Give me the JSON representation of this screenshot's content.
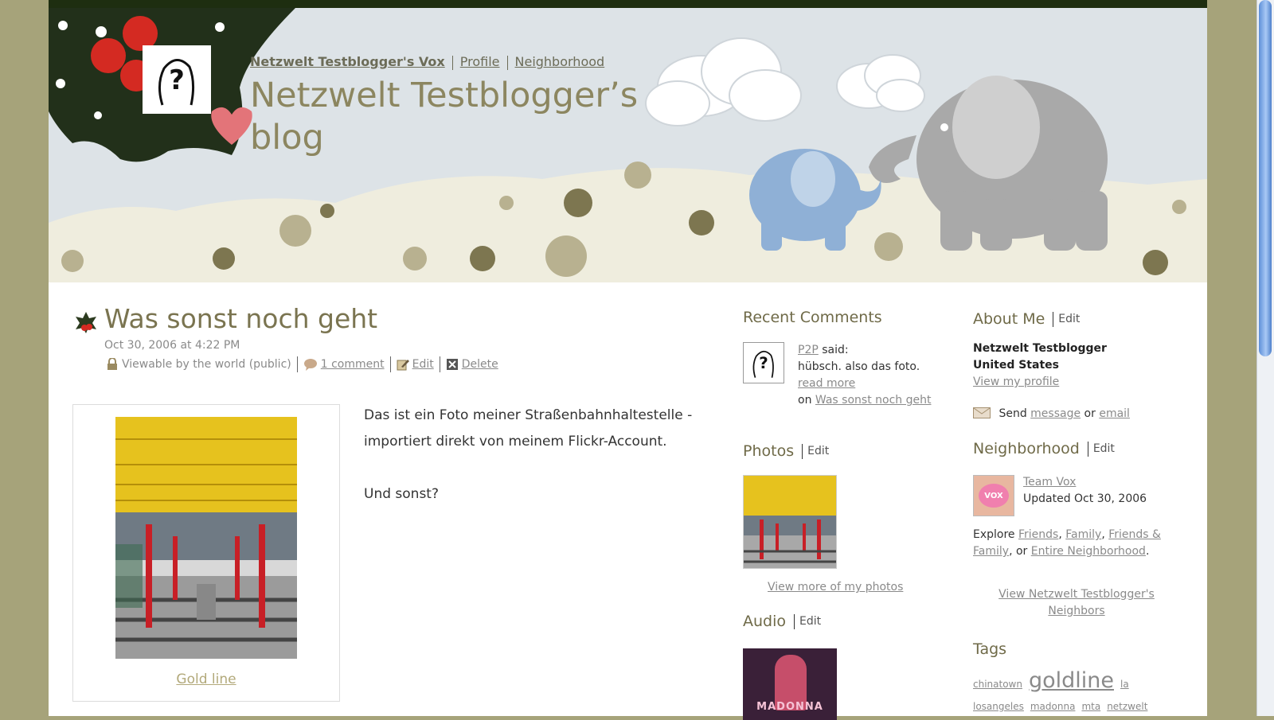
{
  "header": {
    "nav_vox": "Netzwelt Testblogger's Vox",
    "nav_profile": "Profile",
    "nav_neighborhood": "Neighborhood",
    "blog_title": "Netzwelt Testblogger’s blog"
  },
  "post": {
    "title": "Was sonst noch geht",
    "date": "Oct 30, 2006 at 4:22 PM",
    "visibility": "Viewable by the world (public)",
    "comments": "1 comment",
    "edit": "Edit",
    "delete": "Delete",
    "photo_caption": "Gold line",
    "body_p1": "Das ist ein Foto meiner Straßenbahnhaltestelle - importiert direkt von meinem Flickr-Account.",
    "body_p2": "Und sonst?"
  },
  "recent_comments": {
    "heading": "Recent Comments",
    "author": "P2P",
    "said": "said:",
    "text": "hübsch. also das foto.",
    "read_more": "read more",
    "on": "on",
    "post_link": "Was sonst noch geht"
  },
  "photos": {
    "heading": "Photos",
    "edit": "Edit",
    "view_more": "View more of my photos"
  },
  "audio": {
    "heading": "Audio",
    "edit": "Edit",
    "album_text": "MADONNA"
  },
  "about": {
    "heading": "About Me",
    "edit": "Edit",
    "name": "Netzwelt Testblogger",
    "country": "United States",
    "view_profile": "View my profile",
    "send": "Send",
    "message": "message",
    "or": "or",
    "email": "email"
  },
  "neighborhood": {
    "heading": "Neighborhood",
    "edit": "Edit",
    "member_name": "Team Vox",
    "updated": "Updated Oct 30, 2006",
    "explore": "Explore",
    "friends": "Friends",
    "family": "Family",
    "friends_family": "Friends & Family",
    "or": "or",
    "entire": "Entire Neighborhood",
    "view_neighbors": "View Netzwelt Testblogger's Neighbors",
    "avatar_text": "VOX"
  },
  "tags": {
    "heading": "Tags",
    "items": [
      "chinatown",
      "goldline",
      "la",
      "losangeles",
      "madonna",
      "mta",
      "netzwelt"
    ]
  }
}
